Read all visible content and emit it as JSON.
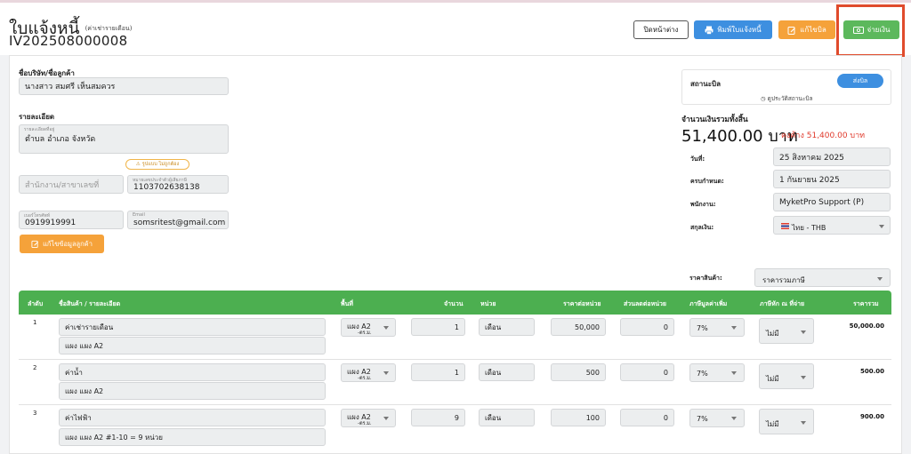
{
  "header": {
    "title": "ใบแจ้งหนี้",
    "title_note": "(ค่าเช่ารายเดือน)",
    "invoice_no": "IV202508000008",
    "close_label": "ปิดหน้าต่าง",
    "print_label": "พิมพ์ใบแจ้งหนี้",
    "edit_label": "แก้ไขบิล",
    "pay_label": "จ่ายเงิน"
  },
  "customer": {
    "company_label": "ชื่อบริษัท/ชื่อลูกค้า",
    "company_value": "นางสาว สมศรี เห็นสมควร",
    "detail_label": "รายละเอียด",
    "address_small": "รายละเอียดที่อยู่",
    "address_value": "ตำบล อำเภอ จังหวัด",
    "warn_text": "รูปแบบ ไม่ถูกต้อง",
    "branch_placeholder": "สำนักงาน/สาขาเลขที่",
    "tax_small": "หมายเลขประจำตัวผู้เสียภาษี",
    "tax_value": "1103702638138",
    "phone_small": "เบอร์โทรศัพท์",
    "phone_value": "0919919991",
    "email_small": "Email",
    "email_value": "somsritest@gmail.com",
    "edit_button": "แก้ไขข้อมูลลูกค้า"
  },
  "status": {
    "label": "สถานะบิล",
    "badge": "ส่งบิล",
    "history_link": "ดูประวัติสถานะบิล"
  },
  "totals": {
    "label": "จำนวนเงินรวมทั้งสิ้น",
    "amount": "51,400.00 บาท",
    "owed": "คงค้าง 51,400.00 บาท"
  },
  "meta": {
    "date_label": "วันที่:",
    "date_value": "25 สิงหาคม 2025",
    "due_label": "ครบกำหนด:",
    "due_value": "1 กันยายน 2025",
    "staff_label": "พนักงาน:",
    "staff_value": "MyketPro Support (P)",
    "currency_label": "สกุลเงิน:",
    "currency_value": "ไทย - THB",
    "price_label": "ราคาสินค้า:",
    "price_value": "ราคารวมภาษี"
  },
  "table": {
    "headers": [
      "ลำดับ",
      "ชื่อสินค้า / รายละเอียด",
      "พื้นที่",
      "จำนวน",
      "หน่วย",
      "ราคาต่อหน่วย",
      "ส่วนลดต่อหน่วย",
      "ภาษีมูลค่าเพิ่ม",
      "ภาษีหัก ณ ที่จ่าย",
      "ราคารวม"
    ],
    "rows": [
      {
        "idx": "1",
        "name": "ค่าเช่ารายเดือน",
        "detail": "แผง แผง A2",
        "area": "แผง A2",
        "area_sub": "-ตร.ม.",
        "qty": "1",
        "unit": "เดือน",
        "price": "50,000",
        "discount": "0",
        "vat": "7%",
        "wht": "ไม่มี",
        "total": "50,000.00"
      },
      {
        "idx": "2",
        "name": "ค่าน้ำ",
        "detail": "แผง แผง A2",
        "area": "แผง A2",
        "area_sub": "-ตร.ม.",
        "qty": "1",
        "unit": "เดือน",
        "price": "500",
        "discount": "0",
        "vat": "7%",
        "wht": "ไม่มี",
        "total": "500.00"
      },
      {
        "idx": "3",
        "name": "ค่าไฟฟ้า",
        "detail": "แผง แผง A2 #1-10 = 9 หน่วย",
        "area": "แผง A2",
        "area_sub": "-ตร.ม.",
        "qty": "9",
        "unit": "เดือน",
        "price": "100",
        "discount": "0",
        "vat": "7%",
        "wht": "ไม่มี",
        "total": "900.00"
      }
    ]
  },
  "colors": {
    "primary": "#3d8fe0",
    "warning": "#f5a23a",
    "success": "#5cb85c",
    "table_header": "#4caf50",
    "danger": "#e03a2c"
  }
}
